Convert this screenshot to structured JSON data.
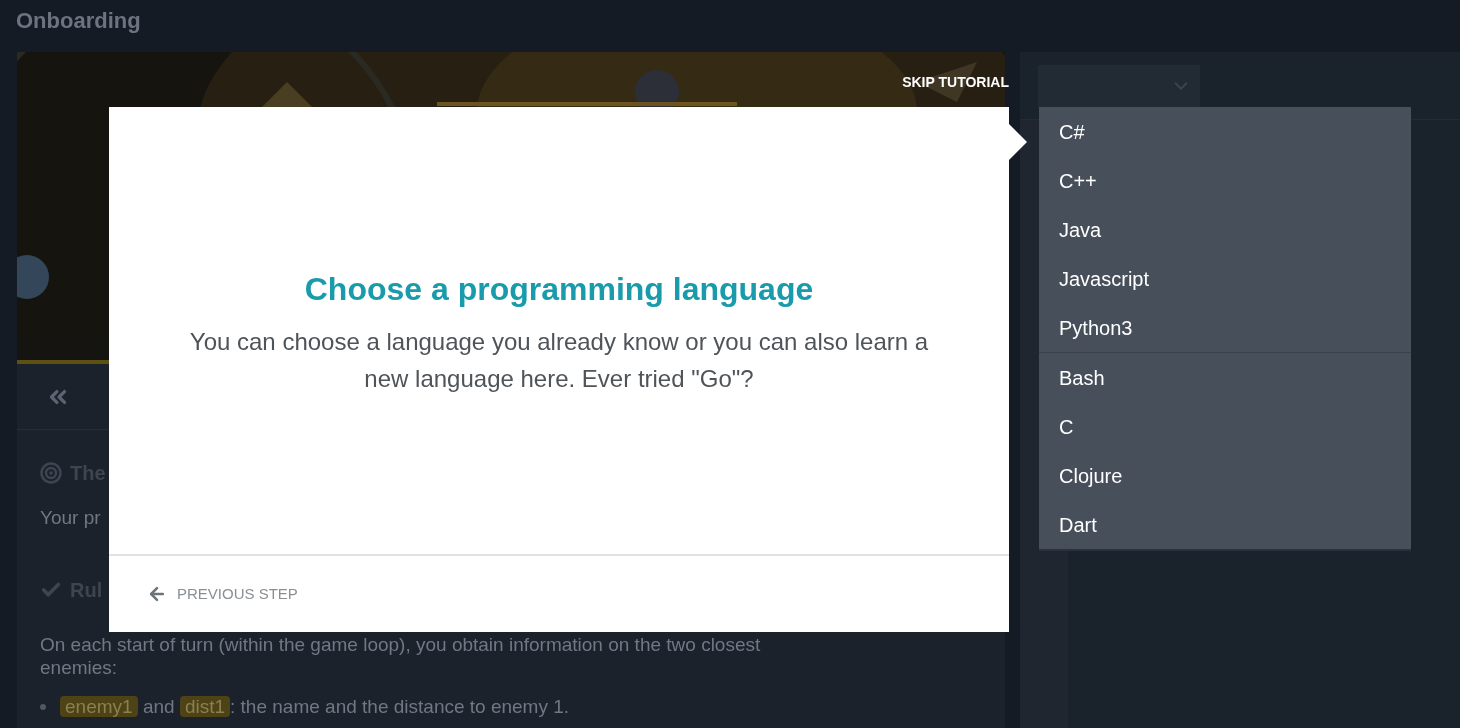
{
  "page": {
    "title": "Onboarding"
  },
  "progress": {
    "level": 1
  },
  "statement": {
    "goal_heading": "The",
    "goal_text": "Your pr",
    "rules_heading": "Rul",
    "rules_text": "On each start of turn (within the game loop), you obtain information on the two closest enemies:",
    "bullets": [
      [
        {
          "kind": "code",
          "text": "enemy1"
        },
        {
          "kind": "text",
          "text": " and "
        },
        {
          "kind": "code",
          "text": "dist1"
        },
        {
          "kind": "text",
          "text": ": the name and the distance to enemy 1."
        }
      ]
    ]
  },
  "tutorial": {
    "skip": "SKIP TUTORIAL",
    "title": "Choose a programming language",
    "body": "You can choose a language you already know or you can also learn a new language here. Ever tried \"Go\"?",
    "previous": "PREVIOUS STEP"
  },
  "language_menu": {
    "groups": [
      [
        "C#",
        "C++",
        "Java",
        "Javascript",
        "Python3"
      ],
      [
        "Bash",
        "C",
        "Clojure",
        "Dart"
      ]
    ]
  }
}
